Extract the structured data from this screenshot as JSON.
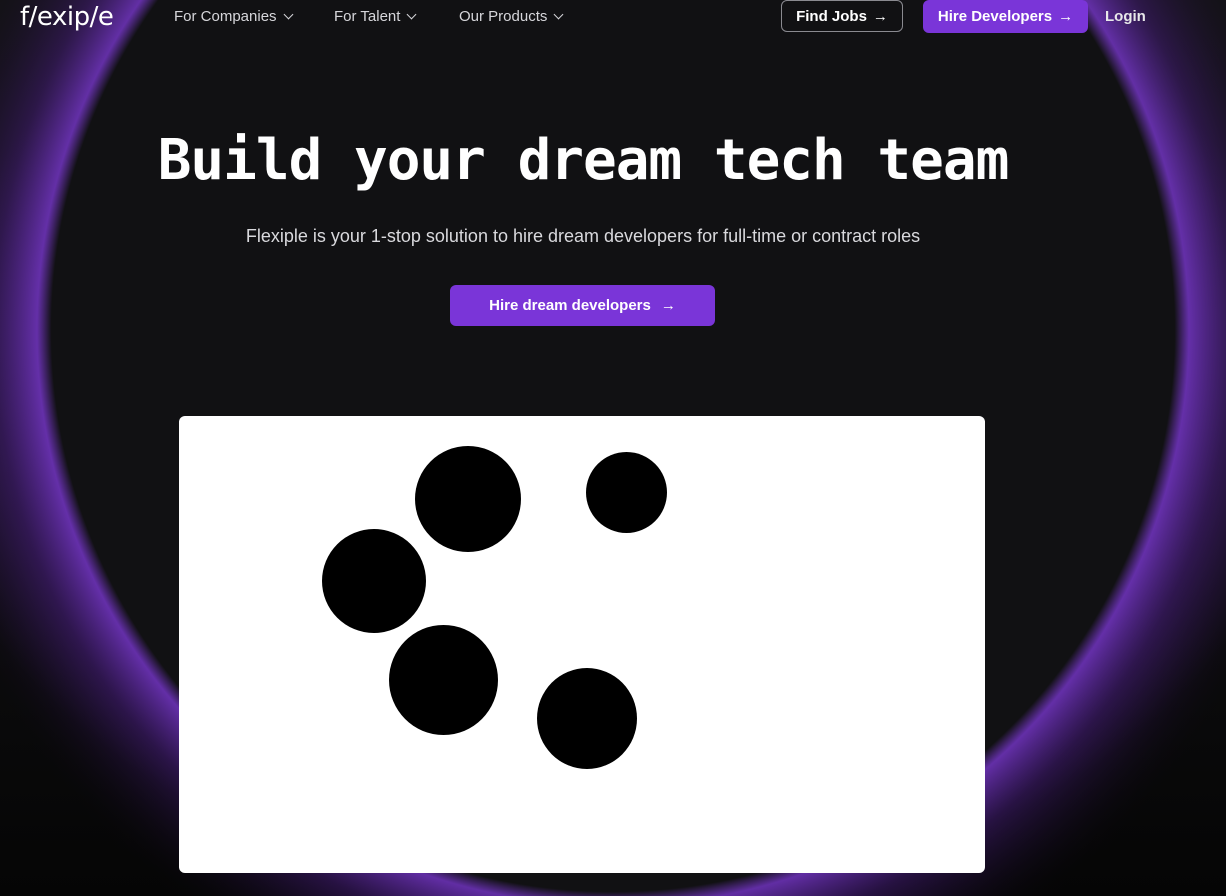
{
  "header": {
    "logo_text": "f/exip/e",
    "nav": [
      {
        "label": "For Companies"
      },
      {
        "label": "For Talent"
      },
      {
        "label": "Our Products"
      }
    ],
    "find_jobs_label": "Find Jobs",
    "hire_developers_label": "Hire Developers",
    "login_label": "Login"
  },
  "hero": {
    "title": "Build your dream tech team",
    "subtitle": "Flexiple is your 1-stop solution to hire dream developers for full-time or contract roles",
    "cta_label": "Hire dream developers"
  },
  "colors": {
    "accent": "#7a35d8",
    "background": "#111113",
    "text": "#ffffff"
  },
  "icons": {
    "nav_chevron": "chevron-down-icon",
    "cta_arrow": "arrow-right-icon"
  }
}
